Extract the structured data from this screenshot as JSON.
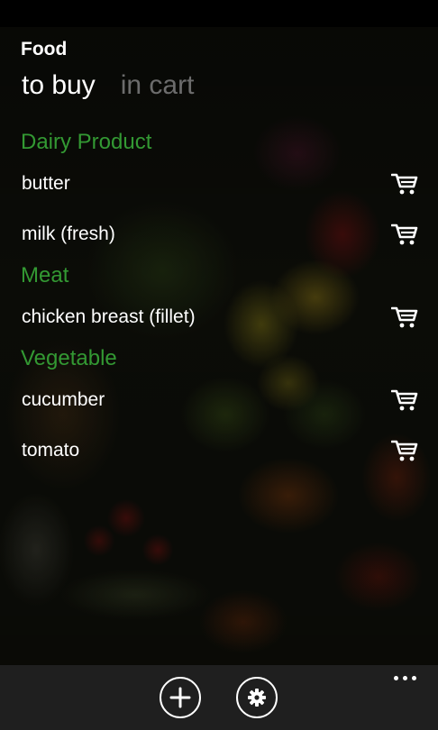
{
  "app": {
    "title": "Food"
  },
  "pivot": {
    "tabs": [
      {
        "label": "to buy",
        "selected": true
      },
      {
        "label": "in cart",
        "selected": false
      }
    ]
  },
  "list": {
    "groups": [
      {
        "header": "Dairy Product",
        "items": [
          {
            "label": "butter",
            "action_icon": "cart-icon"
          },
          {
            "label": "milk (fresh)",
            "action_icon": "cart-icon"
          }
        ]
      },
      {
        "header": "Meat",
        "items": [
          {
            "label": "chicken breast (fillet)",
            "action_icon": "cart-icon"
          }
        ]
      },
      {
        "header": "Vegetable",
        "items": [
          {
            "label": "cucumber",
            "action_icon": "cart-icon"
          },
          {
            "label": "tomato",
            "action_icon": "cart-icon"
          }
        ]
      }
    ]
  },
  "app_bar": {
    "buttons": [
      {
        "icon": "plus-icon"
      },
      {
        "icon": "gear-icon"
      }
    ],
    "more_icon": "ellipsis-icon"
  },
  "colors": {
    "accent": "#339933",
    "text": "#ffffff",
    "inactive_tab": "#6c6c6c",
    "app_bar": "#1f1f1f"
  }
}
